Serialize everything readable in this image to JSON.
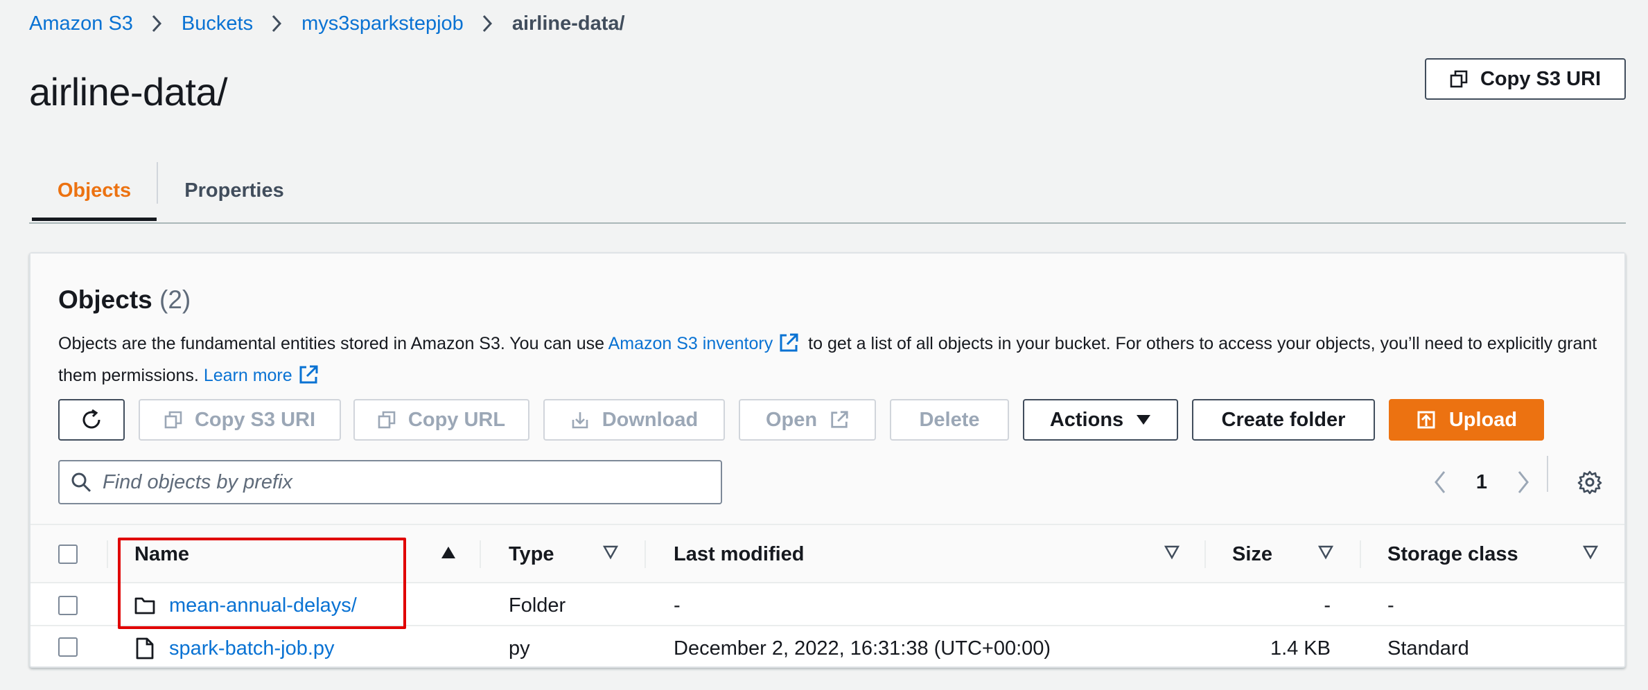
{
  "breadcrumb": {
    "items": [
      "Amazon S3",
      "Buckets",
      "mys3sparkstepjob"
    ],
    "current": "airline-data/"
  },
  "page": {
    "title": "airline-data/",
    "copy_s3_uri_label": "Copy S3 URI"
  },
  "tabs": [
    {
      "label": "Objects",
      "active": true
    },
    {
      "label": "Properties",
      "active": false
    }
  ],
  "objects_panel": {
    "title": "Objects",
    "count": "(2)",
    "description_part1": "Objects are the fundamental entities stored in Amazon S3. You can use",
    "inventory_link": "Amazon S3 inventory",
    "description_part2": "to get a list of all objects in your bucket. For others to access your objects, you’ll need to explicitly grant them permissions.",
    "learn_more": "Learn more"
  },
  "toolbar": {
    "copy_s3_uri": "Copy S3 URI",
    "copy_url": "Copy URL",
    "download": "Download",
    "open": "Open",
    "delete": "Delete",
    "actions": "Actions",
    "create_folder": "Create folder",
    "upload": "Upload"
  },
  "search": {
    "placeholder": "Find objects by prefix",
    "value": ""
  },
  "pagination": {
    "current_page": "1"
  },
  "table": {
    "columns": [
      "Name",
      "Type",
      "Last modified",
      "Size",
      "Storage class"
    ],
    "rows": [
      {
        "name": "mean-annual-delays/",
        "type": "Folder",
        "last_modified": "-",
        "size": "-",
        "storage_class": "-",
        "icon": "folder-icon"
      },
      {
        "name": "spark-batch-job.py",
        "type": "py",
        "last_modified": "December 2, 2022, 16:31:38 (UTC+00:00)",
        "size": "1.4 KB",
        "storage_class": "Standard",
        "icon": "file-icon"
      }
    ]
  },
  "colors": {
    "accent_orange": "#ec7211",
    "link_blue": "#0972d3",
    "highlight_red": "#e00000"
  }
}
